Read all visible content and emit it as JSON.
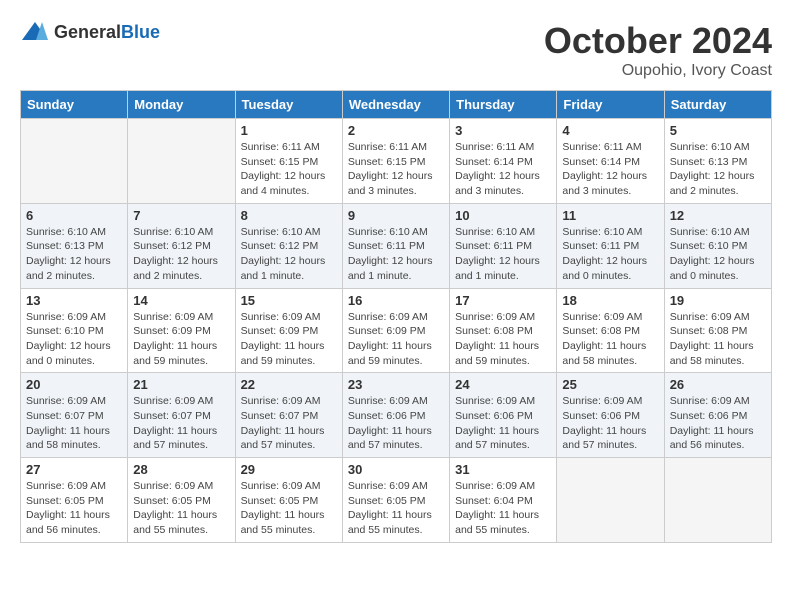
{
  "header": {
    "logo_general": "General",
    "logo_blue": "Blue",
    "month": "October 2024",
    "location": "Oupohio, Ivory Coast"
  },
  "days_of_week": [
    "Sunday",
    "Monday",
    "Tuesday",
    "Wednesday",
    "Thursday",
    "Friday",
    "Saturday"
  ],
  "weeks": [
    [
      {
        "day": "",
        "info": ""
      },
      {
        "day": "",
        "info": ""
      },
      {
        "day": "1",
        "info": "Sunrise: 6:11 AM\nSunset: 6:15 PM\nDaylight: 12 hours and 4 minutes."
      },
      {
        "day": "2",
        "info": "Sunrise: 6:11 AM\nSunset: 6:15 PM\nDaylight: 12 hours and 3 minutes."
      },
      {
        "day": "3",
        "info": "Sunrise: 6:11 AM\nSunset: 6:14 PM\nDaylight: 12 hours and 3 minutes."
      },
      {
        "day": "4",
        "info": "Sunrise: 6:11 AM\nSunset: 6:14 PM\nDaylight: 12 hours and 3 minutes."
      },
      {
        "day": "5",
        "info": "Sunrise: 6:10 AM\nSunset: 6:13 PM\nDaylight: 12 hours and 2 minutes."
      }
    ],
    [
      {
        "day": "6",
        "info": "Sunrise: 6:10 AM\nSunset: 6:13 PM\nDaylight: 12 hours and 2 minutes."
      },
      {
        "day": "7",
        "info": "Sunrise: 6:10 AM\nSunset: 6:12 PM\nDaylight: 12 hours and 2 minutes."
      },
      {
        "day": "8",
        "info": "Sunrise: 6:10 AM\nSunset: 6:12 PM\nDaylight: 12 hours and 1 minute."
      },
      {
        "day": "9",
        "info": "Sunrise: 6:10 AM\nSunset: 6:11 PM\nDaylight: 12 hours and 1 minute."
      },
      {
        "day": "10",
        "info": "Sunrise: 6:10 AM\nSunset: 6:11 PM\nDaylight: 12 hours and 1 minute."
      },
      {
        "day": "11",
        "info": "Sunrise: 6:10 AM\nSunset: 6:11 PM\nDaylight: 12 hours and 0 minutes."
      },
      {
        "day": "12",
        "info": "Sunrise: 6:10 AM\nSunset: 6:10 PM\nDaylight: 12 hours and 0 minutes."
      }
    ],
    [
      {
        "day": "13",
        "info": "Sunrise: 6:09 AM\nSunset: 6:10 PM\nDaylight: 12 hours and 0 minutes."
      },
      {
        "day": "14",
        "info": "Sunrise: 6:09 AM\nSunset: 6:09 PM\nDaylight: 11 hours and 59 minutes."
      },
      {
        "day": "15",
        "info": "Sunrise: 6:09 AM\nSunset: 6:09 PM\nDaylight: 11 hours and 59 minutes."
      },
      {
        "day": "16",
        "info": "Sunrise: 6:09 AM\nSunset: 6:09 PM\nDaylight: 11 hours and 59 minutes."
      },
      {
        "day": "17",
        "info": "Sunrise: 6:09 AM\nSunset: 6:08 PM\nDaylight: 11 hours and 59 minutes."
      },
      {
        "day": "18",
        "info": "Sunrise: 6:09 AM\nSunset: 6:08 PM\nDaylight: 11 hours and 58 minutes."
      },
      {
        "day": "19",
        "info": "Sunrise: 6:09 AM\nSunset: 6:08 PM\nDaylight: 11 hours and 58 minutes."
      }
    ],
    [
      {
        "day": "20",
        "info": "Sunrise: 6:09 AM\nSunset: 6:07 PM\nDaylight: 11 hours and 58 minutes."
      },
      {
        "day": "21",
        "info": "Sunrise: 6:09 AM\nSunset: 6:07 PM\nDaylight: 11 hours and 57 minutes."
      },
      {
        "day": "22",
        "info": "Sunrise: 6:09 AM\nSunset: 6:07 PM\nDaylight: 11 hours and 57 minutes."
      },
      {
        "day": "23",
        "info": "Sunrise: 6:09 AM\nSunset: 6:06 PM\nDaylight: 11 hours and 57 minutes."
      },
      {
        "day": "24",
        "info": "Sunrise: 6:09 AM\nSunset: 6:06 PM\nDaylight: 11 hours and 57 minutes."
      },
      {
        "day": "25",
        "info": "Sunrise: 6:09 AM\nSunset: 6:06 PM\nDaylight: 11 hours and 57 minutes."
      },
      {
        "day": "26",
        "info": "Sunrise: 6:09 AM\nSunset: 6:06 PM\nDaylight: 11 hours and 56 minutes."
      }
    ],
    [
      {
        "day": "27",
        "info": "Sunrise: 6:09 AM\nSunset: 6:05 PM\nDaylight: 11 hours and 56 minutes."
      },
      {
        "day": "28",
        "info": "Sunrise: 6:09 AM\nSunset: 6:05 PM\nDaylight: 11 hours and 55 minutes."
      },
      {
        "day": "29",
        "info": "Sunrise: 6:09 AM\nSunset: 6:05 PM\nDaylight: 11 hours and 55 minutes."
      },
      {
        "day": "30",
        "info": "Sunrise: 6:09 AM\nSunset: 6:05 PM\nDaylight: 11 hours and 55 minutes."
      },
      {
        "day": "31",
        "info": "Sunrise: 6:09 AM\nSunset: 6:04 PM\nDaylight: 11 hours and 55 minutes."
      },
      {
        "day": "",
        "info": ""
      },
      {
        "day": "",
        "info": ""
      }
    ]
  ]
}
